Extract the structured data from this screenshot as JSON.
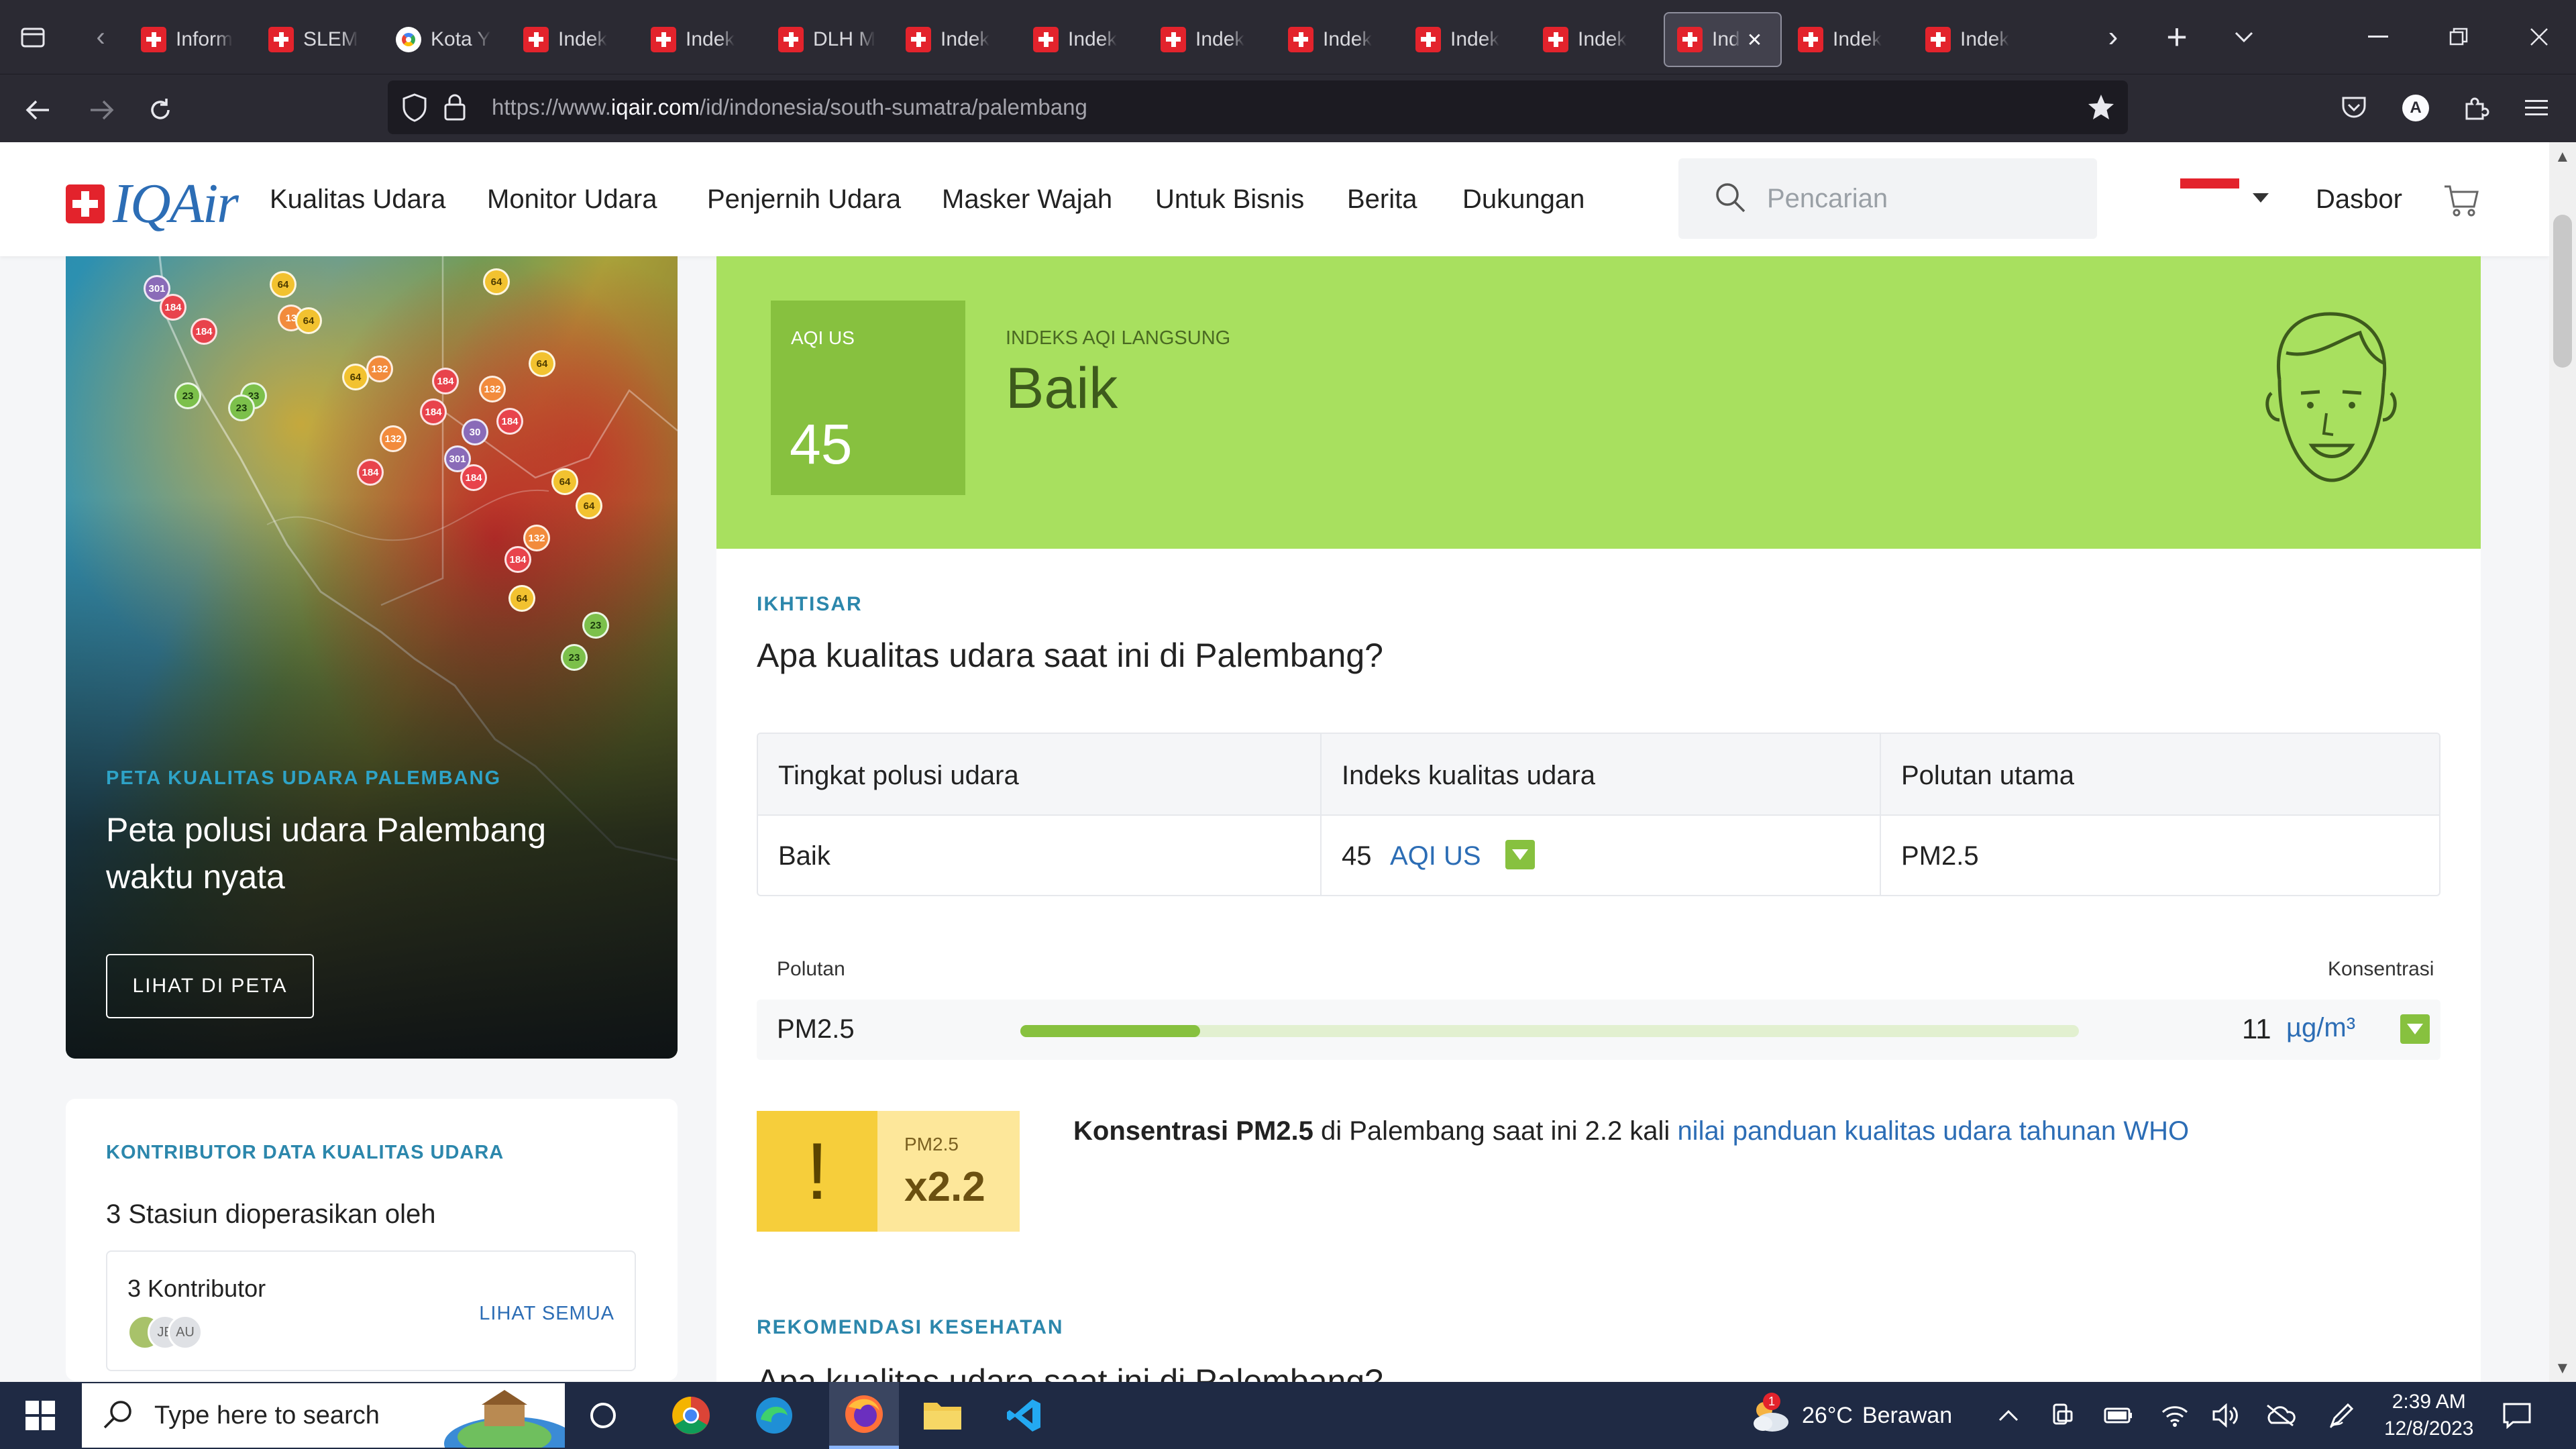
{
  "browser": {
    "tabs": [
      {
        "label": "Inform",
        "icon": "iqair-cross-icon"
      },
      {
        "label": "SLEM",
        "icon": "iqair-cross-icon"
      },
      {
        "label": "Kota Y",
        "icon": "google-icon"
      },
      {
        "label": "Indek",
        "icon": "iqair-cross-icon"
      },
      {
        "label": "Indek",
        "icon": "iqair-cross-icon"
      },
      {
        "label": "DLH M",
        "icon": "iqair-cross-icon"
      },
      {
        "label": "Indek",
        "icon": "iqair-cross-icon"
      },
      {
        "label": "Indek",
        "icon": "iqair-cross-icon"
      },
      {
        "label": "Indek",
        "icon": "iqair-cross-icon"
      },
      {
        "label": "Indek",
        "icon": "iqair-cross-icon"
      },
      {
        "label": "Indek",
        "icon": "iqair-cross-icon"
      },
      {
        "label": "Indek",
        "icon": "iqair-cross-icon"
      },
      {
        "label": "Ind",
        "icon": "iqair-cross-icon",
        "active": true
      },
      {
        "label": "Indek",
        "icon": "iqair-cross-icon"
      },
      {
        "label": "Indek",
        "icon": "iqair-cross-icon"
      }
    ],
    "url_prefix": "https://www.",
    "url_domain": "iqair.com",
    "url_path": "/id/indonesia/south-sumatra/palembang"
  },
  "site": {
    "logo_text": "IQAir",
    "nav": [
      "Kualitas Udara",
      "Monitor Udara",
      "Penjernih Udara",
      "Masker Wajah",
      "Untuk Bisnis",
      "Berita",
      "Dukungan"
    ],
    "search_placeholder": "Pencarian",
    "dashboard": "Dasbor"
  },
  "map_card": {
    "kicker": "PETA KUALITAS UDARA PALEMBANG",
    "title": "Peta polusi udara Palembang waktu nyata",
    "button": "LIHAT DI PETA",
    "markers": [
      "301",
      "184",
      "184",
      "64",
      "13",
      "64",
      "64",
      "23",
      "132",
      "64",
      "23",
      "23",
      "184",
      "132",
      "184",
      "64",
      "132",
      "30",
      "184",
      "301",
      "184",
      "184",
      "64",
      "64",
      "132",
      "184",
      "64",
      "23",
      "23"
    ]
  },
  "contrib_card": {
    "kicker": "KONTRIBUTOR DATA KUALITAS UDARA",
    "subtitle": "3 Stasiun dioperasikan oleh",
    "contributors_label": "3 Kontributor",
    "see_all": "LIHAT SEMUA",
    "avatars": [
      "",
      "JE",
      "AU"
    ]
  },
  "aqi": {
    "box_label": "AQI US",
    "value": "45",
    "live_label": "INDEKS AQI LANGSUNG",
    "status": "Baik",
    "colors": {
      "hero": "#a8e05f",
      "box": "#87c13f"
    }
  },
  "overview": {
    "kicker": "IKHTISAR",
    "title": "Apa kualitas udara saat ini di Palembang?",
    "table": {
      "headers": [
        "Tingkat polusi udara",
        "Indeks kualitas udara",
        "Polutan utama"
      ],
      "level": "Baik",
      "index_value": "45",
      "index_unit": "AQI US",
      "main_pollutant": "PM2.5"
    }
  },
  "pollutants": {
    "col_pollutant": "Polutan",
    "col_concentration": "Konsentrasi",
    "rows": [
      {
        "name": "PM2.5",
        "value": "11",
        "unit": "µg/m³",
        "bar_fraction": 0.17
      }
    ]
  },
  "who": {
    "label": "PM2.5",
    "multiplier": "x2.2",
    "text_bold": "Konsentrasi PM2.5",
    "text_mid": " di Palembang saat ini 2.2 kali ",
    "text_link": "nilai panduan kualitas udara tahunan WHO"
  },
  "health": {
    "kicker": "REKOMENDASI KESEHATAN",
    "title": "Apa kualitas udara saat ini di Palembang?"
  },
  "taskbar": {
    "search_placeholder": "Type here to search",
    "weather_temp": "26°C",
    "weather_text": "Berawan",
    "weather_badge": "1",
    "time": "2:39 AM",
    "date": "12/8/2023"
  }
}
